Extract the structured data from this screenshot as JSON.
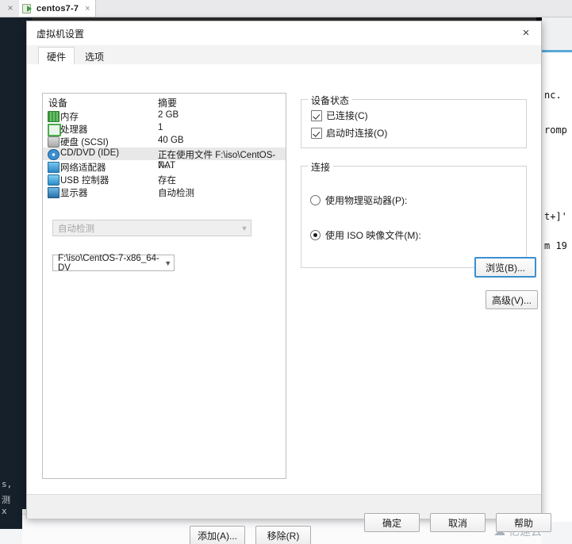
{
  "background": {
    "tab_close_all_icon": "close-icon",
    "tab": {
      "label": "centos7-7",
      "icon": "vm-play-icon",
      "close_icon": "×"
    },
    "terminal_right_lines": [
      "nc.",
      "romp",
      "t+]'",
      "m 19"
    ],
    "terminal_left_lines": [
      "s,",
      "测",
      "x"
    ],
    "watermark": {
      "icon": "cloud-icon",
      "text": "亿速云"
    }
  },
  "dialog": {
    "title": "虚拟机设置",
    "close_icon": "×",
    "tabs": [
      {
        "label": "硬件",
        "active": true
      },
      {
        "label": "选项",
        "active": false
      }
    ],
    "device_list": {
      "headers": {
        "device": "设备",
        "summary": "摘要"
      },
      "rows": [
        {
          "icon": "memory-icon",
          "icon_class": "ico-mem",
          "name": "内存",
          "summary": "2 GB",
          "selected": false
        },
        {
          "icon": "processor-icon",
          "icon_class": "ico-cpu",
          "name": "处理器",
          "summary": "1",
          "selected": false
        },
        {
          "icon": "harddisk-icon",
          "icon_class": "ico-hdd",
          "name": "硬盘 (SCSI)",
          "summary": "40 GB",
          "selected": false
        },
        {
          "icon": "cddvd-icon",
          "icon_class": "ico-cd",
          "name": "CD/DVD (IDE)",
          "summary": "正在使用文件 F:\\iso\\CentOS-7-...",
          "selected": true
        },
        {
          "icon": "network-icon",
          "icon_class": "ico-net",
          "name": "网络适配器",
          "summary": "NAT",
          "selected": false
        },
        {
          "icon": "usb-icon",
          "icon_class": "ico-usb",
          "name": "USB 控制器",
          "summary": "存在",
          "selected": false
        },
        {
          "icon": "display-icon",
          "icon_class": "ico-mon",
          "name": "显示器",
          "summary": "自动检测",
          "selected": false
        }
      ]
    },
    "device_status": {
      "title": "设备状态",
      "connected": {
        "label": "已连接(C)",
        "checked": true
      },
      "connect_at_power_on": {
        "label": "启动时连接(O)",
        "checked": true
      }
    },
    "connection": {
      "title": "连接",
      "use_physical_drive": {
        "label": "使用物理驱动器(P):",
        "selected": false
      },
      "physical_drive_value": "自动检测",
      "use_iso_image": {
        "label": "使用 ISO 映像文件(M):",
        "selected": true
      },
      "iso_path_value": "F:\\iso\\CentOS-7-x86_64-DV",
      "browse_button": "浏览(B)...",
      "advanced_button": "高级(V)..."
    },
    "list_buttons": {
      "add": "添加(A)...",
      "remove": "移除(R)"
    },
    "footer_buttons": {
      "ok": "确定",
      "cancel": "取消",
      "help": "帮助"
    }
  },
  "colors": {
    "accent": "#3a8fd0",
    "dialog_bg": "#f0f0f0",
    "selected_row": "#e8e8e8",
    "desktop_dark": "#2d2d2d",
    "terminal_dark": "#16202b"
  }
}
